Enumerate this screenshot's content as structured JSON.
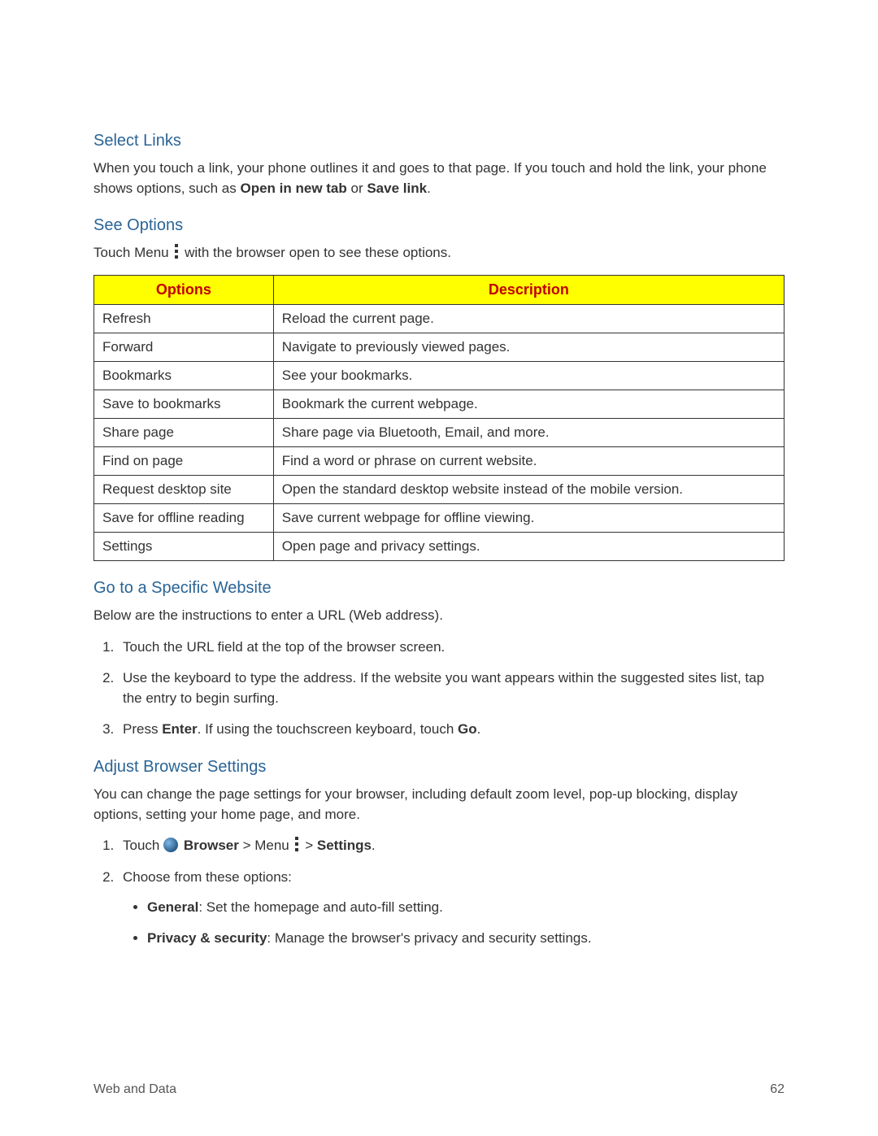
{
  "section1": {
    "heading": "Select Links",
    "para_a": "When you touch a link, your phone outlines it and goes to that page. If you touch and hold the link, your phone shows options, such as ",
    "bold1": "Open in new tab",
    "mid": " or ",
    "bold2": "Save link",
    "end": "."
  },
  "section2": {
    "heading": "See Options",
    "para_a": "Touch Menu ",
    "para_b": " with the browser open to see these options."
  },
  "table": {
    "head_options": "Options",
    "head_description": "Description",
    "rows": [
      {
        "opt": "Refresh",
        "desc": "Reload the current page."
      },
      {
        "opt": "Forward",
        "desc": "Navigate to previously viewed pages."
      },
      {
        "opt": "Bookmarks",
        "desc": "See your bookmarks."
      },
      {
        "opt": "Save to bookmarks",
        "desc": "Bookmark the current webpage."
      },
      {
        "opt": "Share page",
        "desc": "Share page via Bluetooth, Email, and more."
      },
      {
        "opt": "Find on page",
        "desc": "Find a word or phrase on current website."
      },
      {
        "opt": "Request desktop site",
        "desc": "Open the standard desktop website instead of the mobile version."
      },
      {
        "opt": "Save for offline reading",
        "desc": "Save current webpage for offline viewing."
      },
      {
        "opt": "Settings",
        "desc": "Open page and privacy settings."
      }
    ]
  },
  "section3": {
    "heading": "Go to a Specific Website",
    "para": "Below are the instructions to enter a URL (Web address).",
    "steps": {
      "s1": "Touch the URL field at the top of the browser screen.",
      "s2": "Use the keyboard to type the address. If the website you want appears within the suggested sites list, tap the entry to begin surfing.",
      "s3a": "Press ",
      "s3b1": "Enter",
      "s3c": ". If using the touchscreen keyboard, touch ",
      "s3b2": "Go",
      "s3d": "."
    }
  },
  "section4": {
    "heading": "Adjust Browser Settings",
    "para": "You can change the page settings for your browser, including default zoom level, pop-up blocking, display options, setting your home page, and more.",
    "step1": {
      "a": "Touch ",
      "browser": "Browser",
      "gt1": " > Menu ",
      "gt2": " > ",
      "settings": "Settings",
      "end": "."
    },
    "step2": "Choose from these options:",
    "bullets": {
      "b1_label": "General",
      "b1_text": ": Set the homepage and auto-fill setting.",
      "b2_label": "Privacy & security",
      "b2_text": ": Manage the browser's privacy and security settings."
    }
  },
  "footer": {
    "left": "Web and Data",
    "right": "62"
  }
}
